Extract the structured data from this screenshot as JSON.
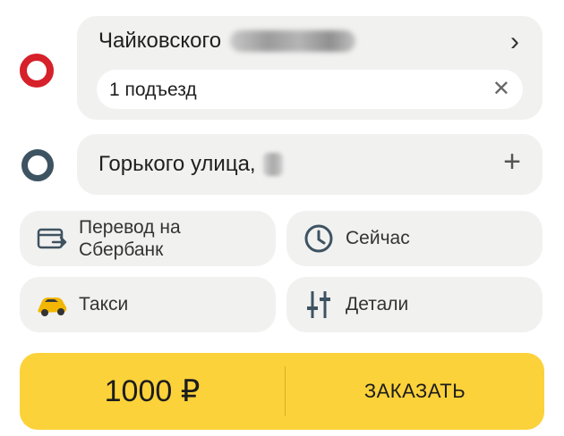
{
  "route": {
    "from": {
      "address": "Чайковского",
      "entrance": "1 подъезд",
      "chevron_icon": "chevron-right-icon",
      "clear_icon": "close-icon"
    },
    "to": {
      "address": "Горького улица,",
      "add_icon": "plus-icon"
    },
    "colors": {
      "from_marker": "#d6202a",
      "to_marker": "#3e5361"
    }
  },
  "options": {
    "payment": {
      "label": "Перевод на Сбербанк",
      "icon": "payment-card-icon"
    },
    "time": {
      "label": "Сейчас",
      "icon": "clock-icon"
    },
    "tariff": {
      "label": "Такси",
      "icon": "taxi-car-icon"
    },
    "details": {
      "label": "Детали",
      "icon": "sliders-icon"
    }
  },
  "order": {
    "price": "1000 ₽",
    "button_label": "ЗАКАЗАТЬ",
    "accent_color": "#fcd23a"
  }
}
